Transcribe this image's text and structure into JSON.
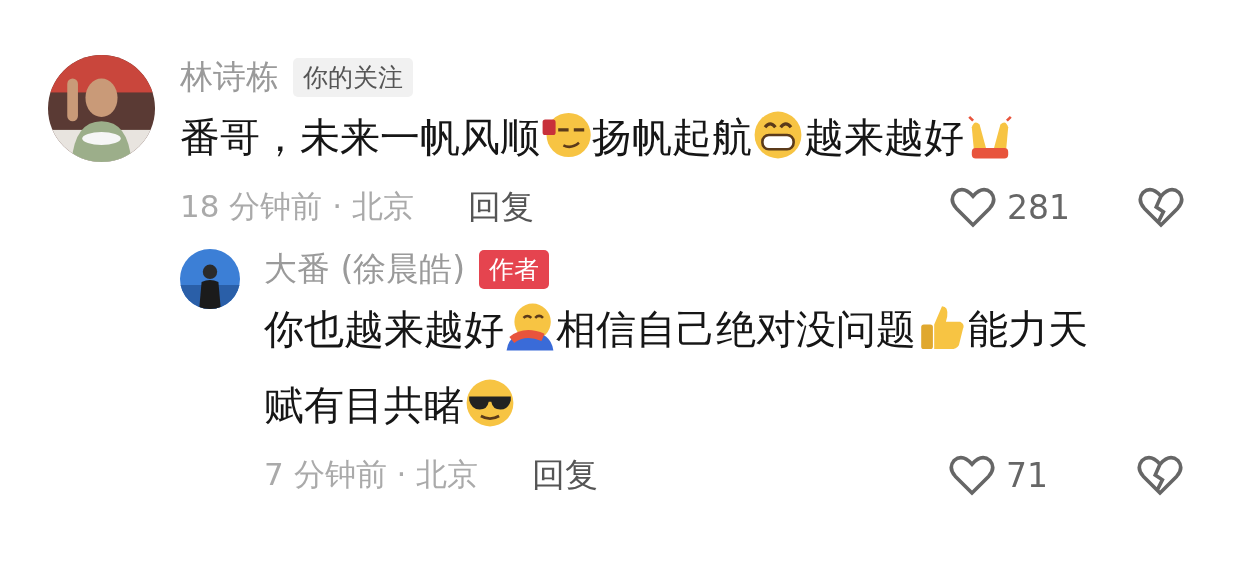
{
  "comments": [
    {
      "author": "林诗栋",
      "tag": {
        "kind": "follow",
        "text": "你的关注"
      },
      "segments": [
        {
          "kind": "text",
          "text": "番哥，未来一帆风顺"
        },
        {
          "kind": "smirk-emoji"
        },
        {
          "kind": "text",
          "text": "扬帆起航"
        },
        {
          "kind": "grin-emoji"
        },
        {
          "kind": "text",
          "text": "越来越好"
        },
        {
          "kind": "clap-emoji"
        }
      ],
      "time": "18 分钟前 · 北京",
      "reply": "回复",
      "likes": "281",
      "replies": [
        {
          "author": "大番 (徐晨皓)",
          "tag": {
            "kind": "author",
            "text": "作者"
          },
          "segments": [
            {
              "kind": "text",
              "text": "你也越来越好"
            },
            {
              "kind": "hug-emoji"
            },
            {
              "kind": "text",
              "text": "相信自己绝对没问题"
            },
            {
              "kind": "thumb-emoji"
            },
            {
              "kind": "text",
              "text": "能力天"
            },
            {
              "kind": "text",
              "text": "赋有目共睹"
            },
            {
              "kind": "cool-emoji"
            }
          ],
          "time": "7 分钟前 · 北京",
          "reply": "回复",
          "likes": "71"
        }
      ]
    }
  ]
}
